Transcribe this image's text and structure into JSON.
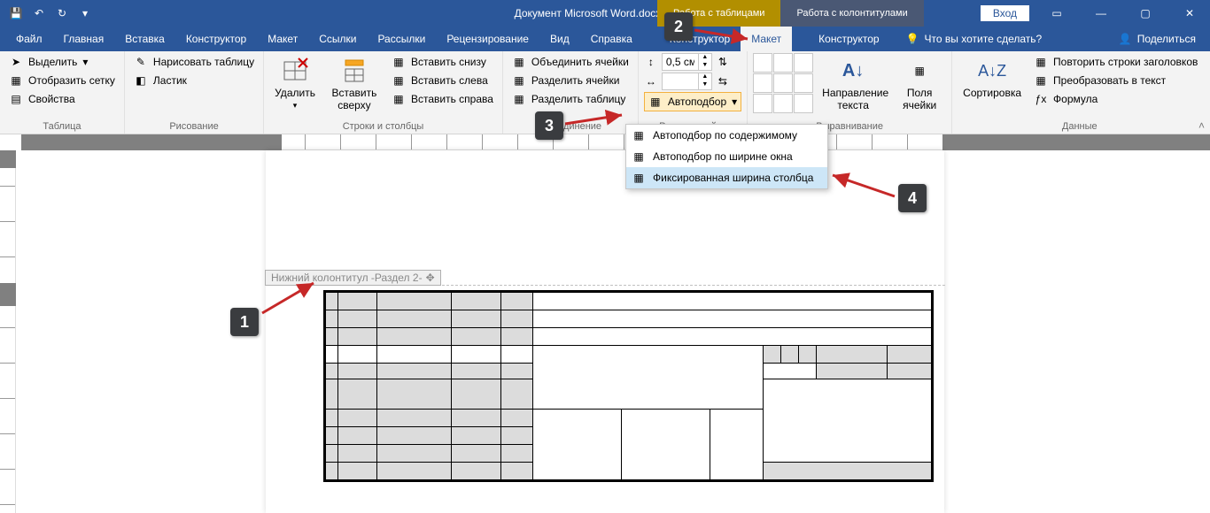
{
  "title": {
    "doc": "Документ Microsoft Word.docx",
    "app": "Word",
    "sep": " - "
  },
  "qat": {
    "save": "💾",
    "undo": "↶",
    "redo": "↻",
    "more": "▾"
  },
  "context_tabs": {
    "tables": "Работа с таблицами",
    "headers": "Работа с колонтитулами"
  },
  "login": "Вход",
  "tabs": {
    "file": "Файл",
    "home": "Главная",
    "insert": "Вставка",
    "design": "Конструктор",
    "layout": "Макет",
    "links": "Ссылки",
    "mailings": "Рассылки",
    "review": "Рецензирование",
    "view": "Вид",
    "help": "Справка",
    "ctx_table_design": "Конструктор",
    "ctx_table_layout": "Макет",
    "ctx_hf_design": "Конструктор",
    "tellme_placeholder": "Что вы хотите сделать?",
    "share": "Поделиться"
  },
  "groups": {
    "table": "Таблица",
    "draw": "Рисование",
    "rowscols": "Строки и столбцы",
    "merge": "Объединение",
    "cellsize": "Размер ячейки",
    "align": "Выравнивание",
    "data": "Данные"
  },
  "table_group": {
    "select": "Выделить",
    "gridlines": "Отобразить сетку",
    "properties": "Свойства"
  },
  "draw_group": {
    "draw": "Нарисовать таблицу",
    "eraser": "Ластик"
  },
  "rowscols": {
    "delete": "Удалить",
    "insert_above": "Вставить сверху",
    "insert_below": "Вставить снизу",
    "insert_left": "Вставить слева",
    "insert_right": "Вставить справа"
  },
  "merge": {
    "merge": "Объединить ячейки",
    "split": "Разделить ячейки",
    "split_table": "Разделить таблицу"
  },
  "cellsize": {
    "height_value": "0,5 см",
    "width_value": "",
    "autofit": "Автоподбор"
  },
  "align_group": {
    "text_dir": "Направление текста",
    "margins": "Поля ячейки"
  },
  "data_group": {
    "sort": "Сортировка",
    "repeat": "Повторить строки заголовков",
    "convert": "Преобразовать в текст",
    "formula": "Формула"
  },
  "autofit_menu": {
    "by_content": "Автоподбор по содержимому",
    "by_window": "Автоподбор по ширине окна",
    "fixed": "Фиксированная ширина столбца"
  },
  "header_label": "Нижний колонтитул -Раздел 2-",
  "annotations": {
    "m1": "1",
    "m2": "2",
    "m3": "3",
    "m4": "4"
  }
}
